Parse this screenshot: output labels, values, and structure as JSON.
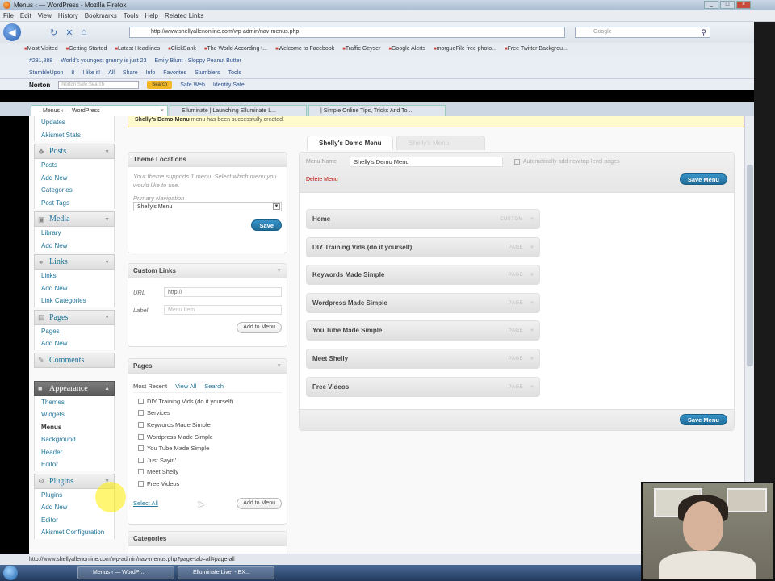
{
  "window": {
    "title": "Menus ‹ — WordPress - Mozilla Firefox"
  },
  "menubar": [
    "File",
    "Edit",
    "View",
    "History",
    "Bookmarks",
    "Tools",
    "Help",
    "Related Links"
  ],
  "navigation": {
    "url": "http://www.shellyallenonline.com/wp-admin/nav-menus.php",
    "search_placeholder": "Google"
  },
  "bookmarks": [
    "Most Visited",
    "Getting Started",
    "Latest Headlines",
    "ClickBank",
    "The World According t...",
    "Welcome to Facebook",
    "Traffic Geyser",
    "Google Alerts",
    "morgueFile free photo...",
    "Free Twitter Backgrou..."
  ],
  "toolbar1": [
    "#281,888",
    "World's youngest granny is just 23",
    "Emily Blunt · Sloppy Peanut Butter"
  ],
  "toolbar2": [
    "StumbleUpon",
    "8",
    "I like it!",
    "All",
    "Share",
    "Info",
    "Favorites",
    "Stumblers",
    "Tools"
  ],
  "toolbar3": {
    "norton": "Norton",
    "search_placeholder": "Norton Safe Search",
    "search_btn": "Search",
    "safe_web": "Safe Web",
    "identity_safe": "Identity Safe"
  },
  "tabs": [
    {
      "label": "Menus ‹ — WordPress",
      "active": true
    },
    {
      "label": "Elluminate | Launching Elluminate L...",
      "active": false
    },
    {
      "label": "| Simple Online Tips, Tricks And To...",
      "active": false
    }
  ],
  "notice": {
    "bold": "Shelly's Demo Menu",
    "text": "menu has been successfully created."
  },
  "sidebar": {
    "top_items": [
      "Updates",
      "Akismet Stats"
    ],
    "sections": [
      {
        "title": "Posts",
        "icon": "pin-icon",
        "items": [
          "Posts",
          "Add New",
          "Categories",
          "Post Tags"
        ]
      },
      {
        "title": "Media",
        "icon": "media-icon",
        "items": [
          "Library",
          "Add New"
        ]
      },
      {
        "title": "Links",
        "icon": "link-icon",
        "items": [
          "Links",
          "Add New",
          "Link Categories"
        ]
      },
      {
        "title": "Pages",
        "icon": "page-icon",
        "items": [
          "Pages",
          "Add New"
        ]
      },
      {
        "title": "Comments",
        "icon": "comment-icon",
        "items": []
      },
      {
        "title": "Appearance",
        "icon": "appearance-icon",
        "open": true,
        "items": [
          "Themes",
          "Widgets",
          "Menus",
          "Background",
          "Header",
          "Editor"
        ],
        "current": "Menus"
      },
      {
        "title": "Plugins",
        "icon": "plugin-icon",
        "items": [
          "Plugins",
          "Add New",
          "Editor",
          "Akismet Configuration"
        ]
      }
    ]
  },
  "theme_locations": {
    "title": "Theme Locations",
    "desc": "Your theme supports 1 menu. Select which menu you would like to use.",
    "label": "Primary Navigation",
    "selected": "Shelly's Menu",
    "save": "Save"
  },
  "custom_links": {
    "title": "Custom Links",
    "url_label": "URL",
    "url_value": "http://",
    "label_label": "Label",
    "label_placeholder": "Menu Item",
    "add": "Add to Menu"
  },
  "pages_box": {
    "title": "Pages",
    "tabs": [
      "Most Recent",
      "View All",
      "Search"
    ],
    "items": [
      "DIY Training Vids (do it yourself)",
      "Services",
      "Keywords Made Simple",
      "Wordpress Made Simple",
      "You Tube Made Simple",
      "Just Sayin'",
      "Meet Shelly",
      "Free Videos"
    ],
    "select_all": "Select All",
    "add": "Add to Menu"
  },
  "categories_box": {
    "title": "Categories"
  },
  "menu_editor": {
    "tabs": [
      "Shelly's Demo Menu",
      "Shelly's Menu"
    ],
    "menu_name_label": "Menu Name",
    "menu_name": "Shelly's Demo Menu",
    "auto_add": "Automatically add new top-level pages",
    "delete": "Delete Menu",
    "save": "Save Menu",
    "items": [
      {
        "title": "Home",
        "type": "CUSTOM"
      },
      {
        "title": "DIY Training Vids (do it yourself)",
        "type": "PAGE"
      },
      {
        "title": "Keywords Made Simple",
        "type": "PAGE"
      },
      {
        "title": "Wordpress Made Simple",
        "type": "PAGE"
      },
      {
        "title": "You Tube Made Simple",
        "type": "PAGE"
      },
      {
        "title": "Meet Shelly",
        "type": "PAGE"
      },
      {
        "title": "Free Videos",
        "type": "PAGE"
      }
    ]
  },
  "statusbar": "http://www.shellyallenonline.com/wp-admin/nav-menus.php?page-tab=all#page-all",
  "taskbar": [
    "Menus ‹ — WordPr...",
    "Elluminate Live! - EX..."
  ],
  "colors": {
    "link": "#21759b",
    "primary_button": "#21759b",
    "delete": "#bc0b0b",
    "notice": "#fffbcc"
  }
}
